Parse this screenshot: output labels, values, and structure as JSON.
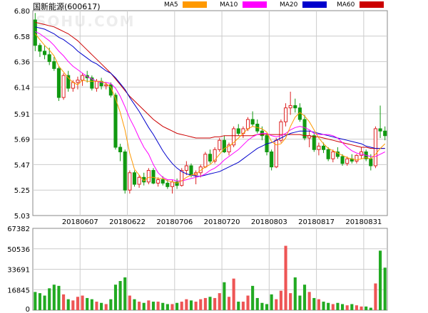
{
  "title": "国新能源(600617)",
  "watermark": "SOHU.COM",
  "legend": [
    {
      "name": "MA5",
      "color": "#ff9900"
    },
    {
      "name": "MA10",
      "color": "#ff00ff"
    },
    {
      "name": "MA20",
      "color": "#0000cc"
    },
    {
      "name": "MA60",
      "color": "#cc0000"
    }
  ],
  "colors": {
    "up": "#dd2222",
    "down": "#119911",
    "grid": "#cccccc",
    "axis": "#888888"
  },
  "chart_data": [
    {
      "type": "candlestick",
      "title": "",
      "ylim": [
        5.03,
        6.8
      ],
      "yticks": [
        "6.80",
        "6.58",
        "6.36",
        "6.14",
        "5.91",
        "5.69",
        "5.47",
        "5.25",
        "5.03"
      ],
      "xtick_labels": [
        {
          "idx": 10,
          "label": "20180607"
        },
        {
          "idx": 20,
          "label": "20180622"
        },
        {
          "idx": 30,
          "label": "20180706"
        },
        {
          "idx": 40,
          "label": "20180720"
        },
        {
          "idx": 50,
          "label": "20180803"
        },
        {
          "idx": 60,
          "label": "20180817"
        },
        {
          "idx": 70,
          "label": "20180831"
        }
      ],
      "ohlc": [
        [
          6.72,
          6.78,
          6.45,
          6.5
        ],
        [
          6.5,
          6.52,
          6.4,
          6.45
        ],
        [
          6.45,
          6.5,
          6.38,
          6.42
        ],
        [
          6.42,
          6.48,
          6.33,
          6.36
        ],
        [
          6.36,
          6.4,
          6.28,
          6.3
        ],
        [
          6.3,
          6.32,
          6.02,
          6.05
        ],
        [
          6.05,
          6.26,
          6.03,
          6.24
        ],
        [
          6.24,
          6.28,
          6.1,
          6.13
        ],
        [
          6.13,
          6.2,
          6.1,
          6.18
        ],
        [
          6.18,
          6.23,
          6.12,
          6.2
        ],
        [
          6.2,
          6.26,
          6.15,
          6.24
        ],
        [
          6.24,
          6.28,
          6.18,
          6.22
        ],
        [
          6.22,
          6.24,
          6.11,
          6.13
        ],
        [
          6.13,
          6.21,
          6.1,
          6.19
        ],
        [
          6.19,
          6.22,
          6.12,
          6.15
        ],
        [
          6.15,
          6.18,
          6.12,
          6.16
        ],
        [
          6.16,
          6.18,
          6.05,
          6.07
        ],
        [
          6.07,
          6.09,
          5.6,
          5.62
        ],
        [
          5.62,
          5.65,
          5.5,
          5.58
        ],
        [
          5.58,
          5.6,
          5.22,
          5.25
        ],
        [
          5.25,
          5.42,
          5.22,
          5.4
        ],
        [
          5.4,
          5.42,
          5.28,
          5.3
        ],
        [
          5.3,
          5.38,
          5.27,
          5.36
        ],
        [
          5.36,
          5.4,
          5.29,
          5.32
        ],
        [
          5.32,
          5.44,
          5.3,
          5.42
        ],
        [
          5.42,
          5.44,
          5.3,
          5.31
        ],
        [
          5.31,
          5.36,
          5.28,
          5.34
        ],
        [
          5.34,
          5.37,
          5.29,
          5.31
        ],
        [
          5.31,
          5.34,
          5.26,
          5.28
        ],
        [
          5.28,
          5.34,
          5.22,
          5.32
        ],
        [
          5.32,
          5.35,
          5.26,
          5.29
        ],
        [
          5.29,
          5.44,
          5.28,
          5.42
        ],
        [
          5.42,
          5.5,
          5.38,
          5.46
        ],
        [
          5.46,
          5.48,
          5.36,
          5.38
        ],
        [
          5.38,
          5.42,
          5.3,
          5.4
        ],
        [
          5.4,
          5.47,
          5.36,
          5.45
        ],
        [
          5.45,
          5.58,
          5.44,
          5.56
        ],
        [
          5.56,
          5.6,
          5.48,
          5.5
        ],
        [
          5.5,
          5.62,
          5.48,
          5.6
        ],
        [
          5.6,
          5.7,
          5.58,
          5.68
        ],
        [
          5.68,
          5.72,
          5.57,
          5.58
        ],
        [
          5.58,
          5.66,
          5.55,
          5.64
        ],
        [
          5.64,
          5.8,
          5.62,
          5.78
        ],
        [
          5.78,
          5.82,
          5.72,
          5.74
        ],
        [
          5.74,
          5.8,
          5.7,
          5.78
        ],
        [
          5.78,
          5.88,
          5.76,
          5.86
        ],
        [
          5.86,
          5.93,
          5.8,
          5.82
        ],
        [
          5.82,
          5.86,
          5.74,
          5.76
        ],
        [
          5.76,
          5.8,
          5.68,
          5.72
        ],
        [
          5.72,
          5.74,
          5.55,
          5.58
        ],
        [
          5.58,
          5.6,
          5.42,
          5.45
        ],
        [
          5.45,
          5.7,
          5.44,
          5.68
        ],
        [
          5.68,
          5.86,
          5.66,
          5.84
        ],
        [
          5.84,
          6.0,
          5.8,
          5.96
        ],
        [
          5.96,
          6.1,
          5.9,
          5.98
        ],
        [
          5.98,
          6.04,
          5.92,
          5.96
        ],
        [
          5.96,
          6.0,
          5.84,
          5.86
        ],
        [
          5.86,
          5.9,
          5.68,
          5.7
        ],
        [
          5.7,
          5.76,
          5.62,
          5.72
        ],
        [
          5.72,
          5.74,
          5.58,
          5.6
        ],
        [
          5.6,
          5.66,
          5.55,
          5.63
        ],
        [
          5.63,
          5.66,
          5.57,
          5.6
        ],
        [
          5.6,
          5.62,
          5.5,
          5.52
        ],
        [
          5.52,
          5.6,
          5.49,
          5.58
        ],
        [
          5.58,
          5.62,
          5.52,
          5.54
        ],
        [
          5.54,
          5.56,
          5.46,
          5.48
        ],
        [
          5.48,
          5.54,
          5.46,
          5.52
        ],
        [
          5.52,
          5.56,
          5.48,
          5.5
        ],
        [
          5.5,
          5.56,
          5.48,
          5.55
        ],
        [
          5.55,
          5.62,
          5.52,
          5.58
        ],
        [
          5.58,
          5.6,
          5.5,
          5.52
        ],
        [
          5.52,
          5.56,
          5.42,
          5.46
        ],
        [
          5.46,
          5.8,
          5.44,
          5.78
        ],
        [
          5.78,
          5.98,
          5.7,
          5.76
        ],
        [
          5.76,
          5.8,
          5.68,
          5.72
        ]
      ],
      "ma5": [
        6.6,
        6.55,
        6.5,
        6.46,
        6.41,
        6.32,
        6.27,
        6.22,
        6.18,
        6.16,
        6.2,
        6.19,
        6.19,
        6.19,
        6.19,
        6.17,
        6.14,
        6.04,
        5.92,
        5.77,
        5.57,
        5.43,
        5.38,
        5.33,
        5.36,
        5.36,
        5.35,
        5.35,
        5.33,
        5.32,
        5.31,
        5.33,
        5.36,
        5.38,
        5.39,
        5.42,
        5.45,
        5.47,
        5.51,
        5.56,
        5.61,
        5.63,
        5.66,
        5.7,
        5.74,
        5.78,
        5.8,
        5.79,
        5.78,
        5.75,
        5.67,
        5.64,
        5.65,
        5.7,
        5.8,
        5.88,
        5.92,
        5.89,
        5.84,
        5.77,
        5.7,
        5.65,
        5.61,
        5.59,
        5.57,
        5.55,
        5.53,
        5.52,
        5.51,
        5.52,
        5.53,
        5.52,
        5.56,
        5.61,
        5.65
      ],
      "ma10": [
        6.62,
        6.6,
        6.57,
        6.54,
        6.5,
        6.45,
        6.41,
        6.36,
        6.32,
        6.29,
        6.26,
        6.23,
        6.21,
        6.19,
        6.18,
        6.18,
        6.17,
        6.13,
        6.06,
        5.97,
        5.87,
        5.79,
        5.7,
        5.62,
        5.56,
        5.47,
        5.4,
        5.36,
        5.34,
        5.34,
        5.33,
        5.33,
        5.34,
        5.35,
        5.36,
        5.37,
        5.39,
        5.42,
        5.44,
        5.47,
        5.51,
        5.54,
        5.57,
        5.6,
        5.64,
        5.68,
        5.71,
        5.73,
        5.74,
        5.74,
        5.72,
        5.71,
        5.72,
        5.74,
        5.77,
        5.79,
        5.8,
        5.79,
        5.77,
        5.74,
        5.73,
        5.73,
        5.73,
        5.72,
        5.7,
        5.66,
        5.62,
        5.59,
        5.57,
        5.56,
        5.55,
        5.54,
        5.54,
        5.56,
        5.58
      ],
      "ma20": [
        6.66,
        6.65,
        6.64,
        6.62,
        6.6,
        6.57,
        6.55,
        6.52,
        6.49,
        6.45,
        6.42,
        6.39,
        6.36,
        6.34,
        6.31,
        6.28,
        6.26,
        6.22,
        6.17,
        6.12,
        6.05,
        5.99,
        5.93,
        5.86,
        5.79,
        5.73,
        5.66,
        5.59,
        5.53,
        5.48,
        5.44,
        5.41,
        5.39,
        5.38,
        5.37,
        5.37,
        5.38,
        5.39,
        5.4,
        5.41,
        5.43,
        5.45,
        5.47,
        5.49,
        5.52,
        5.55,
        5.58,
        5.61,
        5.63,
        5.65,
        5.66,
        5.68,
        5.7,
        5.72,
        5.74,
        5.75,
        5.76,
        5.76,
        5.76,
        5.75,
        5.74,
        5.73,
        5.72,
        5.71,
        5.7,
        5.69,
        5.68,
        5.67,
        5.66,
        5.65,
        5.63,
        5.62,
        5.61,
        5.61,
        5.61
      ],
      "ma60": [
        6.7,
        6.69,
        6.68,
        6.67,
        6.66,
        6.64,
        6.62,
        6.6,
        6.57,
        6.54,
        6.5,
        6.46,
        6.42,
        6.38,
        6.34,
        6.3,
        6.26,
        6.21,
        6.16,
        6.11,
        6.06,
        6.02,
        5.98,
        5.94,
        5.9,
        5.86,
        5.83,
        5.8,
        5.78,
        5.76,
        5.74,
        5.73,
        5.72,
        5.71,
        5.7,
        5.7,
        5.7,
        5.7,
        5.71,
        5.71,
        5.72,
        5.72,
        5.72,
        5.72,
        5.72,
        5.72,
        5.72,
        5.73,
        5.73,
        5.73,
        5.73,
        5.73,
        5.73,
        5.73,
        5.73,
        5.73,
        5.73,
        5.72,
        5.72,
        5.71,
        5.71,
        5.7,
        5.69,
        5.68,
        5.67,
        5.66,
        5.65,
        5.64,
        5.63,
        5.62,
        5.62,
        5.61,
        5.61,
        5.61,
        5.61
      ]
    },
    {
      "type": "bar",
      "title": "",
      "ylim": [
        0,
        67382
      ],
      "yticks": [
        "67382",
        "50536",
        "33691",
        "16845",
        "0"
      ],
      "volume": [
        15000,
        14000,
        12000,
        18000,
        21000,
        20000,
        13000,
        9000,
        8000,
        11000,
        12000,
        10000,
        9000,
        7000,
        6000,
        5000,
        9000,
        21000,
        24000,
        27000,
        12000,
        9000,
        7000,
        6000,
        8000,
        7000,
        7000,
        6000,
        5000,
        5000,
        6000,
        7000,
        9000,
        8000,
        7000,
        9000,
        10000,
        11000,
        10000,
        14000,
        23000,
        11000,
        26000,
        7000,
        7000,
        12000,
        20000,
        10000,
        6000,
        5000,
        13000,
        9000,
        16000,
        53000,
        14000,
        27000,
        12000,
        21000,
        15000,
        10000,
        9000,
        7000,
        6000,
        5000,
        6000,
        5000,
        4000,
        5000,
        4000,
        3000,
        3000,
        2000,
        22000,
        49000,
        35000
      ]
    }
  ]
}
